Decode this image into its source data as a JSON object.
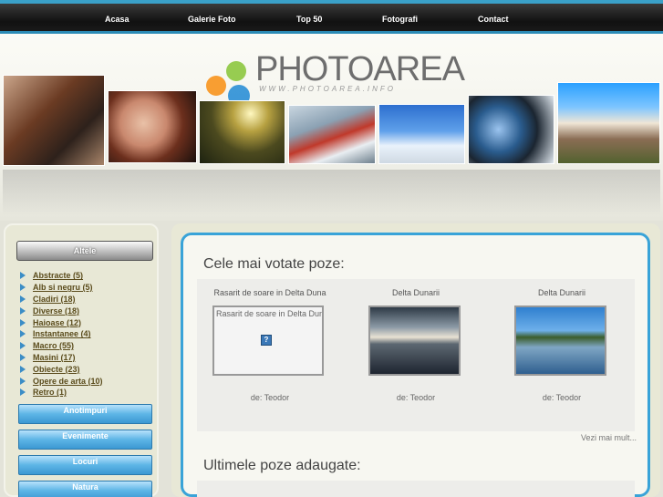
{
  "nav": {
    "items": [
      "Acasa",
      "Galerie Foto",
      "Top 50",
      "Fotografi",
      "Contact"
    ]
  },
  "logo": {
    "text": "PHOTOAREA",
    "subtitle": "WWW.PHOTOAREA.INFO"
  },
  "sidebar": {
    "header": "Altele",
    "categories": [
      "Abstracte (5)",
      "Alb si negru (5)",
      "Cladiri (18)",
      "Diverse (18)",
      "Haioase (12)",
      "Instantanee (4)",
      "Macro (55)",
      "Masini (17)",
      "Obiecte (23)",
      "Opere de arta (10)",
      "Retro (1)"
    ],
    "buttons": [
      "Anotimpuri",
      "Evenimente",
      "Locuri",
      "Natura"
    ]
  },
  "main": {
    "top_title": "Cele mai votate poze:",
    "photos": [
      {
        "title": "Rasarit de soare in Delta Duna",
        "alt": "Rasarit de soare in Delta Duna",
        "author": "de: Teodor"
      },
      {
        "title": "Delta Dunarii",
        "author": "de: Teodor"
      },
      {
        "title": "Delta Dunarii",
        "author": "de: Teodor"
      }
    ],
    "more": "Vezi mai mult...",
    "latest_title": "Ultimele poze adaugate:"
  },
  "colors": {
    "accent_blue": "#39a3d8",
    "nav_bg": "#111111",
    "category_text": "#5a4b1b"
  },
  "icons": {
    "broken_image": "broken-image-icon",
    "bullet": "arrow-right-icon"
  }
}
